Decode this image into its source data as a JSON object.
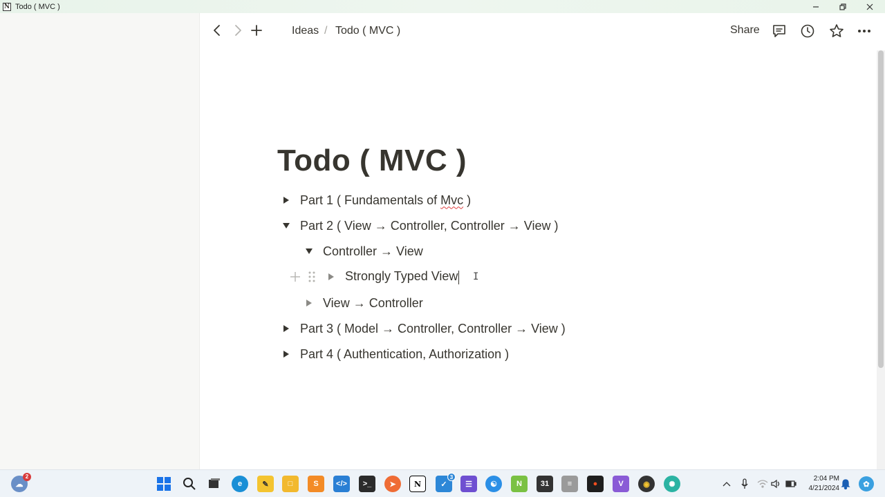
{
  "window": {
    "title": "Todo ( MVC )",
    "app_icon": "N"
  },
  "breadcrumb": {
    "parent": "Ideas",
    "separator": "/",
    "current": "Todo ( MVC )"
  },
  "topbar": {
    "share_label": "Share",
    "icons": [
      "back-icon",
      "forward-icon",
      "plus-icon",
      "comments-icon",
      "history-icon",
      "star-icon",
      "more-icon"
    ]
  },
  "page": {
    "title": "Todo ( MVC )",
    "toggles": [
      {
        "label_pre": "Part 1 ( Fundamentals of ",
        "label_misspelled": "Mvc",
        "label_post": " )",
        "expanded": false
      },
      {
        "label": "Part 2 ( View → Controller, Controller → View )",
        "expanded": true
      },
      {
        "label": "Controller → View",
        "expanded": true
      },
      {
        "label": "Strongly Typed View",
        "expanded": false,
        "empty": true,
        "focused": true
      },
      {
        "label": "View → Controller",
        "expanded": false,
        "empty": true
      },
      {
        "label": "Part 3 ( Model → Controller, Controller → View )",
        "expanded": false
      },
      {
        "label": "Part 4 ( Authentication, Authorization )",
        "expanded": false
      }
    ]
  },
  "taskbar": {
    "weather_badge": "2",
    "vscode_badge": "3",
    "apps": [
      "windows-start",
      "search",
      "task-view",
      "edge",
      "sticky-notes",
      "file-explorer",
      "sublime-text",
      "vscode",
      "terminal",
      "postman",
      "notion",
      "azure-devops",
      "github-desktop",
      "edge-beta",
      "nodemon",
      "calendar",
      "database",
      "figma",
      "vs-insiders",
      "chrome-canary",
      "edge-dev"
    ],
    "time": "2:04 PM",
    "date": "4/21/2024"
  }
}
